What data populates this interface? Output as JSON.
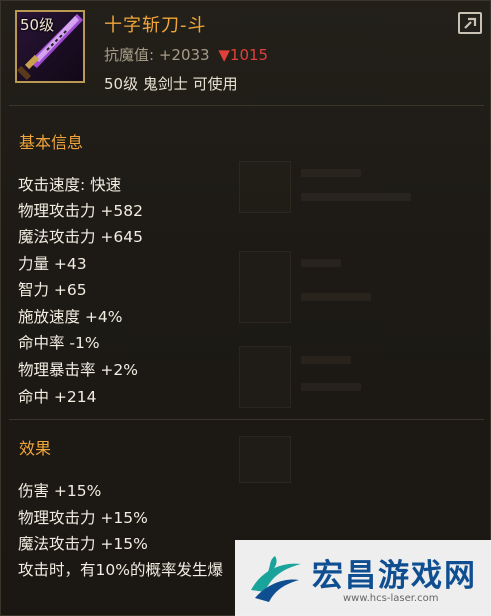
{
  "item": {
    "level_badge": "50级",
    "name": "十字斩刀-斗",
    "magic_resist_label": "抗魔值:",
    "magic_resist_value": "+2033",
    "magic_resist_change": "▼1015",
    "requirement": "50级 鬼剑士 可使用"
  },
  "basic_info": {
    "title": "基本信息",
    "attributes": [
      "攻击速度: 快速",
      "物理攻击力 +582",
      "魔法攻击力 +645",
      "力量 +43",
      "智力 +65",
      "施放速度 +4%",
      "命中率 -1%",
      "物理暴击率 +2%",
      "命中 +214"
    ]
  },
  "effects": {
    "title": "效果",
    "lines": [
      "伤害 +15%",
      "物理攻击力 +15%",
      "魔法攻击力 +15%",
      "攻击时，有10%的概率发生爆"
    ]
  },
  "watermark": {
    "brand": "宏昌游戏网",
    "url": "www.hcs-laser.com"
  },
  "icons": [
    "sword-item-icon",
    "share-icon",
    "watermark-logo-icon"
  ],
  "colors": {
    "title_orange": "#f0a53a",
    "text_white": "#f2ede2",
    "stat_grey": "#a69c88",
    "down_red": "#e0413a",
    "frame_gold": "#b99a52"
  }
}
